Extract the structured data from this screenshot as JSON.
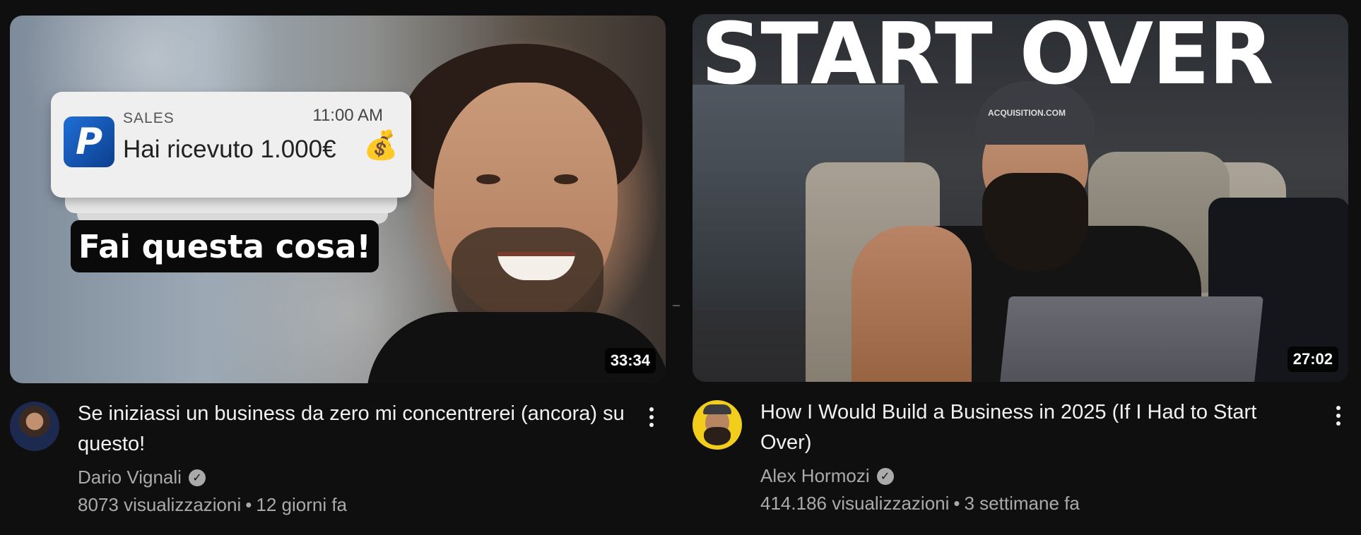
{
  "videos": [
    {
      "title": "Se iniziassi un business da zero mi concentrerei (ancora) su questo!",
      "channel": "Dario Vignali",
      "views": "8073 visualizzazioni",
      "age": "12 giorni fa",
      "duration": "33:34",
      "thumbnail": {
        "notification_app": "SALES",
        "notification_time": "11:00 AM",
        "notification_message": "Hai ricevuto 1.000€",
        "notification_emoji": "💰",
        "logo_letter": "P",
        "caption": "Fai questa cosa!"
      },
      "verified": true
    },
    {
      "title": "How I Would Build a Business in 2025 (If I Had to Start Over)",
      "channel": "Alex Hormozi",
      "views": "414.186 visualizzazioni",
      "age": "3 settimane fa",
      "duration": "27:02",
      "thumbnail": {
        "headline": "START OVER",
        "cap_text": "ACQUISITION.COM"
      },
      "verified": true
    }
  ],
  "separator": "•",
  "verified_glyph": "✓",
  "colors": {
    "background": "#0f0f0f",
    "primary_text": "#f1f1f1",
    "secondary_text": "#aaaaaa",
    "avatar_alex_bg": "#f2cd1c"
  }
}
